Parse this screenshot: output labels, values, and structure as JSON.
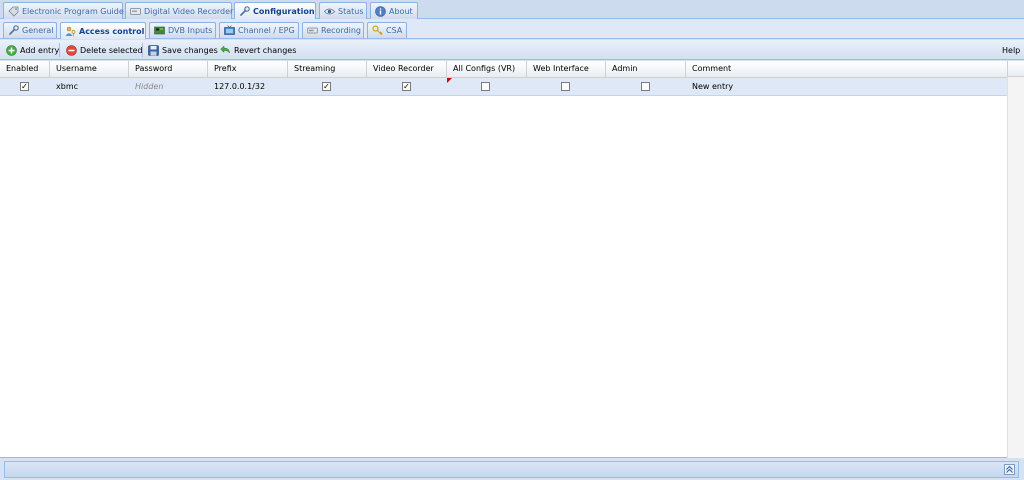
{
  "top_tabs": [
    {
      "label": "Electronic Program Guide",
      "icon": "tag-icon",
      "active": false
    },
    {
      "label": "Digital Video Recorder",
      "icon": "video-recorder-icon",
      "active": false
    },
    {
      "label": "Configuration",
      "icon": "wrench-icon",
      "active": true
    },
    {
      "label": "Status",
      "icon": "eye-icon",
      "active": false
    },
    {
      "label": "About",
      "icon": "info-icon",
      "active": false
    }
  ],
  "sub_tabs": [
    {
      "label": "General",
      "icon": "wrench-icon",
      "active": false
    },
    {
      "label": "Access control",
      "icon": "users-key-icon",
      "active": true
    },
    {
      "label": "DVB Inputs",
      "icon": "dvb-card-icon",
      "active": false
    },
    {
      "label": "Channel / EPG",
      "icon": "tv-icon",
      "active": false
    },
    {
      "label": "Recording",
      "icon": "recorder-icon",
      "active": false
    },
    {
      "label": "CSA",
      "icon": "key-icon",
      "active": false
    }
  ],
  "toolbar": {
    "add_label": "Add entry",
    "delete_label": "Delete selected",
    "save_label": "Save changes",
    "revert_label": "Revert changes",
    "help_label": "Help"
  },
  "grid": {
    "columns": [
      "Enabled",
      "Username",
      "Password",
      "Prefix",
      "Streaming",
      "Video Recorder",
      "All Configs (VR)",
      "Web Interface",
      "Admin",
      "Comment"
    ],
    "rows": [
      {
        "enabled": true,
        "username": "xbmc",
        "password": "Hidden",
        "prefix": "127.0.0.1/32",
        "streaming": true,
        "video_recorder": true,
        "all_configs": false,
        "web_interface": false,
        "admin": false,
        "comment": "New entry"
      }
    ]
  },
  "colors": {
    "accent": "#15428b",
    "panel_bg": "#dfe8f6",
    "border": "#99bbe8",
    "dirty_marker": "#d00000"
  }
}
